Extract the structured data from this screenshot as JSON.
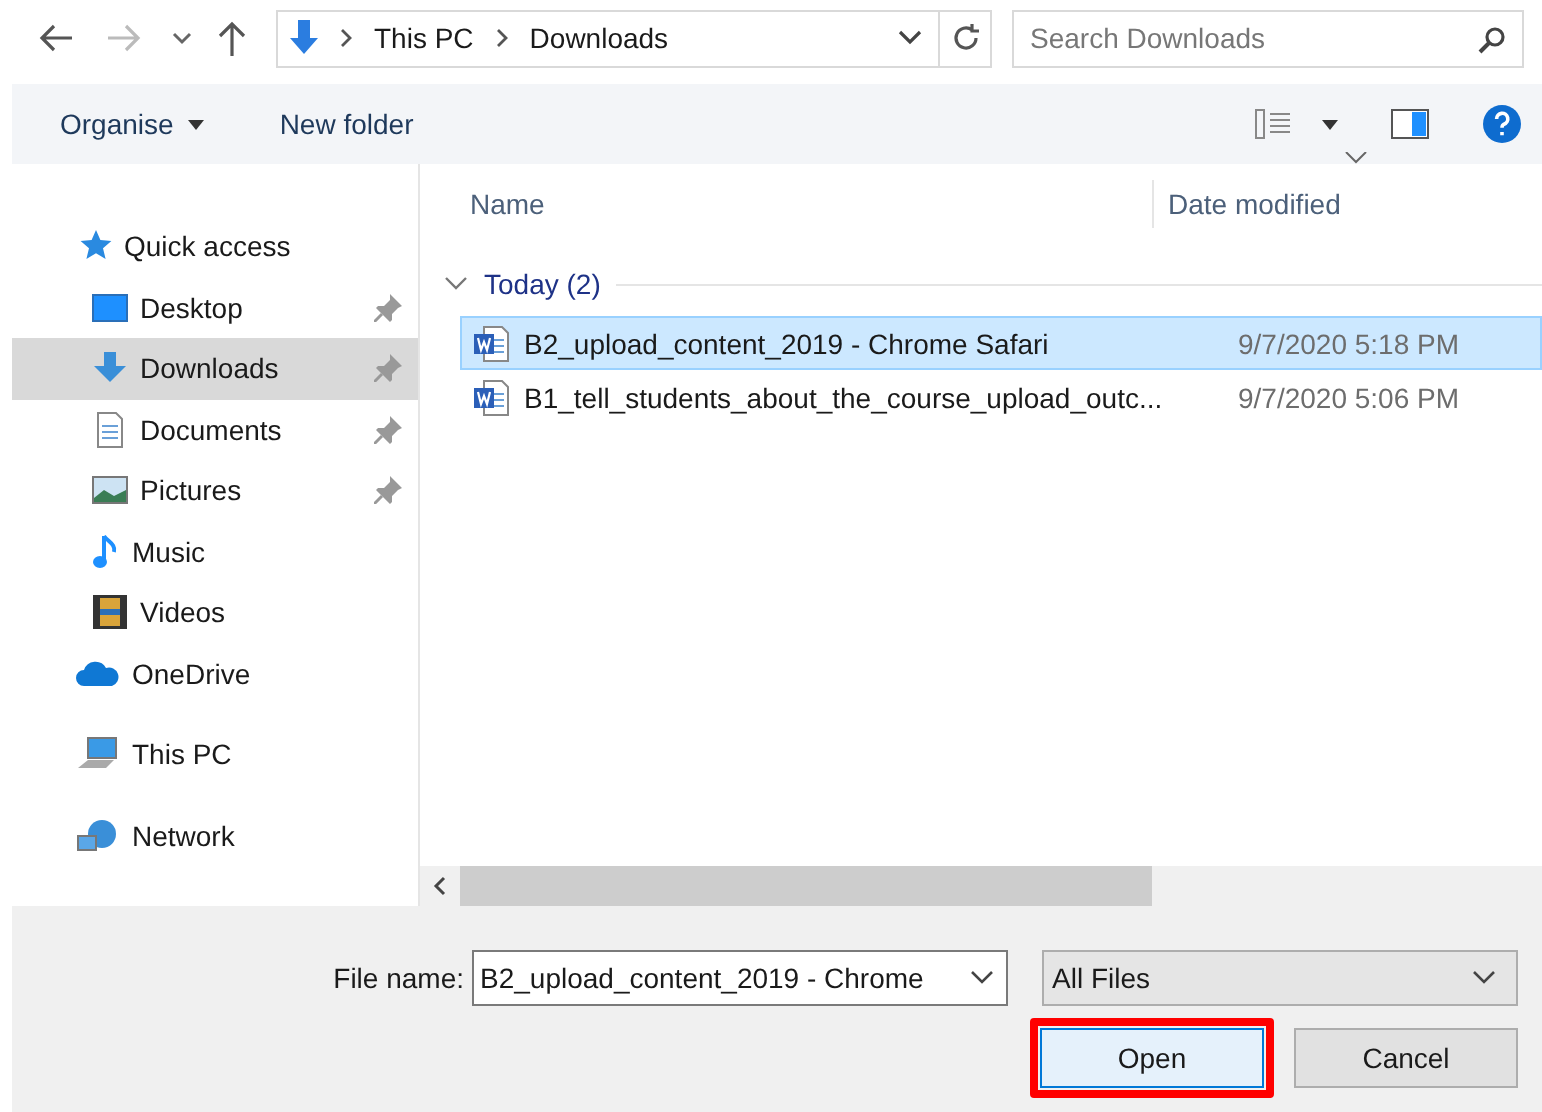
{
  "address": {
    "crumbs": [
      "This PC",
      "Downloads"
    ]
  },
  "search": {
    "placeholder": "Search Downloads"
  },
  "toolbar": {
    "organise": "Organise",
    "new_folder": "New folder"
  },
  "sidebar": {
    "items": [
      {
        "label": "Quick access",
        "selected": false,
        "children": [
          {
            "label": "Desktop",
            "selected": false,
            "pinned": true
          },
          {
            "label": "Downloads",
            "selected": true,
            "pinned": true
          },
          {
            "label": "Documents",
            "selected": false,
            "pinned": true
          },
          {
            "label": "Pictures",
            "selected": false,
            "pinned": true
          },
          {
            "label": "Music",
            "selected": false,
            "pinned": false
          },
          {
            "label": "Videos",
            "selected": false,
            "pinned": false
          }
        ]
      },
      {
        "label": "OneDrive",
        "selected": false
      },
      {
        "label": "This PC",
        "selected": false
      },
      {
        "label": "Network",
        "selected": false
      }
    ]
  },
  "table": {
    "columns": [
      "Name",
      "Date modified"
    ],
    "groups": [
      {
        "label": "Today (2)",
        "expanded": true,
        "rows": [
          {
            "name": "B2_upload_content_2019 - Chrome Safari",
            "date": "9/7/2020 5:18 PM",
            "selected": true
          },
          {
            "name": "B1_tell_students_about_the_course_upload_outc...",
            "date": "9/7/2020 5:06 PM",
            "selected": false
          }
        ]
      }
    ]
  },
  "footer": {
    "file_name_label": "File name:",
    "file_name": "B2_upload_content_2019 - Chrome",
    "filter": "All Files",
    "buttons": [
      {
        "label": "Open",
        "highlighted": true
      },
      {
        "label": "Cancel",
        "highlighted": false
      }
    ]
  }
}
